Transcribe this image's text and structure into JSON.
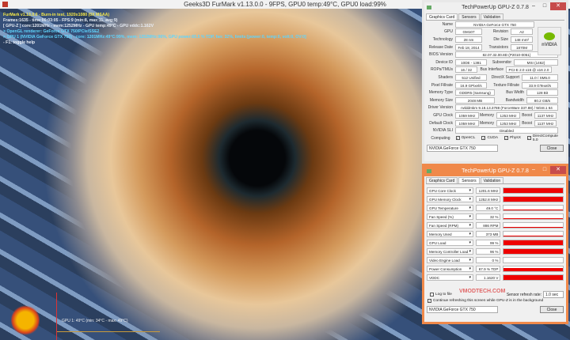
{
  "titlebar": {
    "title": "Geeks3D FurMark v1.13.0.0 - 9FPS, GPU0 temp:49°C, GPU0 load:99%"
  },
  "overlay": [
    "FurMark v1.13.0.0 - Burn-in test, 1920x1080 (0X MSAA)",
    "Frames:1635 - time:00:03:05 - FPS:9 (min:8, max:11, avg:9)",
    "[ GPU-Z ] core:1201MHz - mem:1252MHz - GPU temp:49°C - GPU vddc:1.162V",
    "> OpenGL renderer: GeForce GTX 750/PCIe/SSE2",
    "> GPU 1 (NVIDIA GeForce GTX 750) - core: 1201MHz:49°C:99%, mem: 1252MHz:96%, GPU power:65.5 % TDP, fan: 32%, limits:[power:0, temp:0, volt:0, OV:0]",
    "- F1: toggle help"
  ],
  "graph_label": "GPU 1: 49°C (min: 34°C - max: 49°C)",
  "gpuz": {
    "title": "TechPowerUp GPU-Z 0.7.8",
    "tabs": [
      "Graphics Card",
      "Sensors",
      "Validation"
    ],
    "logo": "nVIDIA",
    "close": "Close",
    "device": "NVIDIA GeForce GTX 750",
    "card": {
      "name": "NVIDIA GeForce GTX 750",
      "gpu": "GM107",
      "revision": "A2",
      "technology": "28 nm",
      "die_size": "148 mm²",
      "release_date": "Feb 18, 2014",
      "transistors": "1870M",
      "bios": "82.07.32.00.8D (P2010-0051)",
      "device_id": "10DE - 1381",
      "subvendor": "MSI (1462)",
      "rops": "16 / 32",
      "bus": "PCI-E 2.0 x16 @ x16 2.0",
      "shaders": "512 Unified",
      "directx": "11.0 / SM5.0",
      "pixel_fill": "16.9 GPixel/s",
      "texture_fill": "33.9 GTexel/s",
      "memory_type": "GDDR5 (Samsung)",
      "bus_width": "128 Bit",
      "memory_size": "2048 MB",
      "bandwidth": "80.2 GB/s",
      "driver": "nvlddmkm 9.18.13.3788 (ForceWare 337.88) / Win8.1 64",
      "gpu_clock": "1059 MHz",
      "memory_clock": "1253 MHz",
      "boost": "1137 MHz",
      "def_clock": "1059 MHz",
      "def_memory": "1253 MHz",
      "def_boost": "1137 MHz",
      "sli": "Disabled"
    },
    "labels": {
      "name": "Name",
      "gpu": "GPU",
      "revision": "Revision",
      "technology": "Technology",
      "die_size": "Die Size",
      "release_date": "Release Date",
      "transistors": "Transistors",
      "bios": "BIOS Version",
      "device_id": "Device ID",
      "subvendor": "Subvendor",
      "rops": "ROPs/TMUs",
      "bus": "Bus Interface",
      "shaders": "Shaders",
      "directx": "DirectX Support",
      "pixel_fill": "Pixel Fillrate",
      "texture_fill": "Texture Fillrate",
      "memory_type": "Memory Type",
      "bus_width": "Bus Width",
      "memory_size": "Memory Size",
      "bandwidth": "Bandwidth",
      "driver": "Driver Version",
      "gpu_clock": "GPU Clock",
      "memory": "Memory",
      "boost": "Boost",
      "def_clock": "Default Clock",
      "sli": "NVIDIA SLI",
      "computing": "Computing"
    },
    "computing": [
      "OpenCL",
      "CUDA",
      "PhysX",
      "DirectCompute 5.0"
    ],
    "sensors": [
      {
        "name": "GPU Core Clock",
        "value": "1201.6 MHz",
        "level": 1.0
      },
      {
        "name": "GPU Memory Clock",
        "value": "1252.8 MHz",
        "level": 1.0
      },
      {
        "name": "GPU Temperature",
        "value": "49.0 °C",
        "level": 0.15
      },
      {
        "name": "Fan Speed (%)",
        "value": "32 %",
        "level": 0.1
      },
      {
        "name": "Fan Speed (RPM)",
        "value": "886 RPM",
        "level": 0.1
      },
      {
        "name": "Memory Used",
        "value": "373 MB",
        "level": 0.15
      },
      {
        "name": "GPU Load",
        "value": "99 %",
        "level": 1.0
      },
      {
        "name": "Memory Controller Load",
        "value": "96 %",
        "level": 0.95
      },
      {
        "name": "Video Engine Load",
        "value": "0 %",
        "level": 0.0
      },
      {
        "name": "Power Consumption",
        "value": "67.9 % TDP",
        "level": 0.6
      },
      {
        "name": "VDDC",
        "value": "1.1620 V",
        "level": 0.9
      }
    ],
    "log_label": "Log to file",
    "refresh_label": "Sensor refresh rate:",
    "refresh_value": "1.0 sec",
    "continue_label": "Continue refreshing this screen while GPU-Z is in the background"
  },
  "watermark": "VMODTECH.COM"
}
